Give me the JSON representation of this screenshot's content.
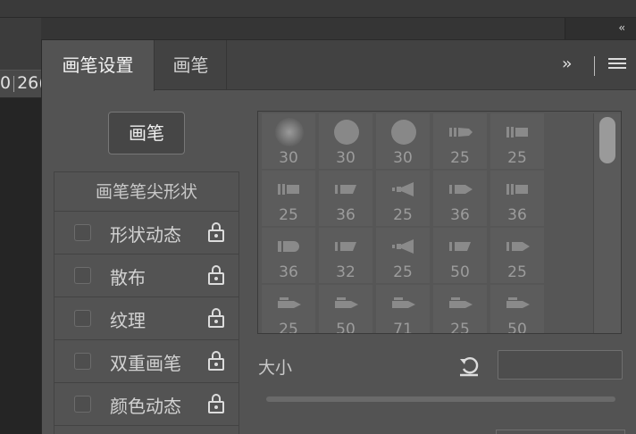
{
  "workspace": {
    "collapse_label": "‹‹",
    "ruler_left": "0",
    "ruler_right": "26("
  },
  "panel": {
    "tabs": [
      {
        "label": "画笔设置",
        "active": true
      },
      {
        "label": "画笔",
        "active": false
      }
    ],
    "expand_label": "››",
    "brush_button_label": "画笔",
    "settings": {
      "header": "画笔笔尖形状",
      "items": [
        {
          "label": "形状动态",
          "checked": false,
          "icon": "lock-icon"
        },
        {
          "label": "散布",
          "checked": false,
          "icon": "lock-icon"
        },
        {
          "label": "纹理",
          "checked": false,
          "icon": "lock-icon"
        },
        {
          "label": "双重画笔",
          "checked": false,
          "icon": "lock-icon"
        },
        {
          "label": "颜色动态",
          "checked": false,
          "icon": "lock-icon"
        }
      ]
    },
    "presets": [
      {
        "size": "30",
        "tip": "soft-round"
      },
      {
        "size": "30",
        "tip": "hard-round"
      },
      {
        "size": "30",
        "tip": "hard-round"
      },
      {
        "size": "25",
        "tip": "flat-pencil"
      },
      {
        "size": "25",
        "tip": "flat-brush"
      },
      {
        "size": "25",
        "tip": "flat-brush"
      },
      {
        "size": "36",
        "tip": "angled-brush"
      },
      {
        "size": "25",
        "tip": "fan-brush"
      },
      {
        "size": "36",
        "tip": "point-brush"
      },
      {
        "size": "36",
        "tip": "flat-brush"
      },
      {
        "size": "36",
        "tip": "round-brush"
      },
      {
        "size": "32",
        "tip": "angled-brush"
      },
      {
        "size": "25",
        "tip": "fan-brush"
      },
      {
        "size": "50",
        "tip": "angled-brush"
      },
      {
        "size": "25",
        "tip": "point-brush"
      },
      {
        "size": "25",
        "tip": "marker"
      },
      {
        "size": "50",
        "tip": "marker"
      },
      {
        "size": "71",
        "tip": "marker"
      },
      {
        "size": "25",
        "tip": "marker"
      },
      {
        "size": "50",
        "tip": "marker"
      }
    ],
    "size_label": "大小",
    "size_value": "",
    "colors": {
      "panel_bg": "#535353",
      "tab_bar_bg": "#424242",
      "text_light": "#f2f2f2",
      "number_gray": "#9c9c9c"
    }
  }
}
